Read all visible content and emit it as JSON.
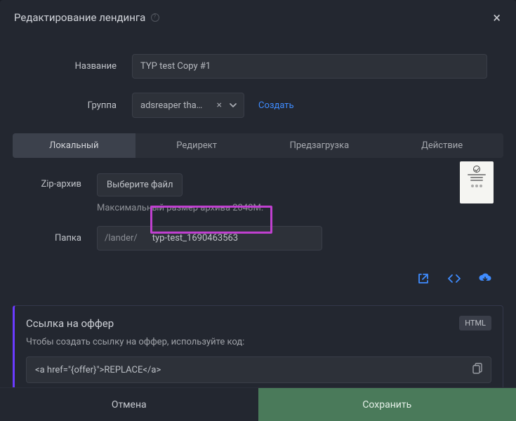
{
  "header": {
    "title": "Редактирование лендинга"
  },
  "form": {
    "name_label": "Название",
    "name_value": "TYP test Copy #1",
    "group_label": "Группа",
    "group_value": "adsreaper tha…",
    "create_link": "Создать"
  },
  "tabs": [
    "Локальный",
    "Редирект",
    "Предзагрузка",
    "Действие"
  ],
  "zip": {
    "label": "Zip-архив",
    "button": "Выберите файл",
    "hint": "Максимальный размер архива 2048M."
  },
  "folder": {
    "label": "Папка",
    "prefix": "/lander/",
    "value": "typ-test_1690463563"
  },
  "offer": {
    "title": "Ссылка на оффер",
    "badge": "HTML",
    "hint": "Чтобы создать ссылку на оффер, используйте код:",
    "code": "<a href=\"{offer}\">REPLACE</a>"
  },
  "actions": {
    "cancel": "Отмена",
    "save": "Сохранить"
  }
}
